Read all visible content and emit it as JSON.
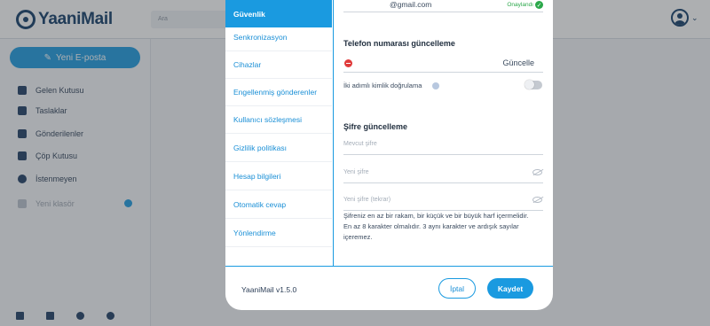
{
  "app": {
    "logo_text": "YaaniMail",
    "search_placeholder": "Ara",
    "compose_label": "Yeni E-posta",
    "nav": [
      {
        "label": "Gelen Kutusu",
        "icon": "inbox-icon"
      },
      {
        "label": "Taslaklar",
        "icon": "drafts-icon"
      },
      {
        "label": "Gönderilenler",
        "icon": "sent-icon"
      },
      {
        "label": "Çöp Kutusu",
        "icon": "trash-icon"
      },
      {
        "label": "İstenmeyen",
        "icon": "spam-icon"
      },
      {
        "label": "Yeni klasör",
        "icon": "folder-icon"
      }
    ],
    "footer_icons": [
      "mail-icon",
      "contacts-icon",
      "settings-icon",
      "help-icon"
    ]
  },
  "settings": {
    "tabs": [
      "Güvenlik",
      "Senkronizasyon",
      "Cihazlar",
      "Engellenmiş gönderenler",
      "Kullanıcı sözleşmesi",
      "Gizlilik politikası",
      "Hesap bilgileri",
      "Otomatik cevap",
      "Yönlendirme"
    ],
    "active_tab": "Güvenlik",
    "email": {
      "value": "@gmail.com",
      "status": "Onaylandı"
    },
    "phone": {
      "title": "Telefon numarası güncelleme",
      "update_label": "Güncelle"
    },
    "twofa": {
      "label": "İki adımlı kimlik doğrulama",
      "enabled": false
    },
    "password": {
      "title": "Şifre güncelleme",
      "current_placeholder": "Mevcut şifre",
      "new_placeholder": "Yeni şifre",
      "repeat_placeholder": "Yeni şifre (tekrar)",
      "hint": "Şifreniz en az bir rakam, bir küçük ve bir büyük harf içermelidir. En az 8 karakter olmalıdır. 3 aynı karakter ve ardışık sayılar içeremez."
    },
    "footer": {
      "version": "YaaniMail v1.5.0",
      "cancel_label": "İptal",
      "save_label": "Kaydet"
    }
  },
  "colors": {
    "accent": "#1a9ae0",
    "brand": "#0f3a66",
    "verified": "#2ba84a"
  }
}
